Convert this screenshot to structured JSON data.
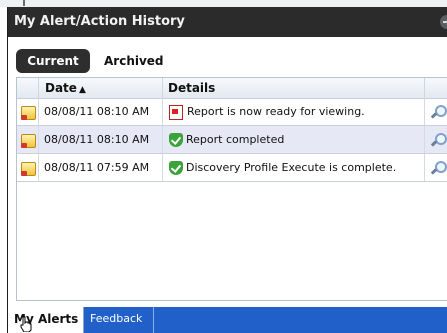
{
  "window": {
    "title": "My Alert/Action History"
  },
  "tabs": [
    {
      "label": "Current",
      "active": true
    },
    {
      "label": "Archived",
      "active": false
    }
  ],
  "table": {
    "columns": {
      "date": "Date",
      "date_sort": "▲",
      "details": "Details"
    },
    "rows": [
      {
        "date": "08/08/11 08:10 AM",
        "details": "Report is now ready for viewing.",
        "status_icon": "pdf-icon"
      },
      {
        "date": "08/08/11 08:10 AM",
        "details": "Report completed",
        "status_icon": "checkmark-shield-icon"
      },
      {
        "date": "08/08/11 07:59 AM",
        "details": "Discovery Profile Execute is complete.",
        "status_icon": "checkmark-shield-icon"
      }
    ]
  },
  "bottom_tabs": [
    {
      "label": "My Alerts",
      "active": true
    },
    {
      "label": "Feedback",
      "active": false
    }
  ],
  "colors": {
    "titlebar": "#2b2b2b",
    "bottom_bar": "#2060c8",
    "alt_row": "#e7e8f6"
  }
}
